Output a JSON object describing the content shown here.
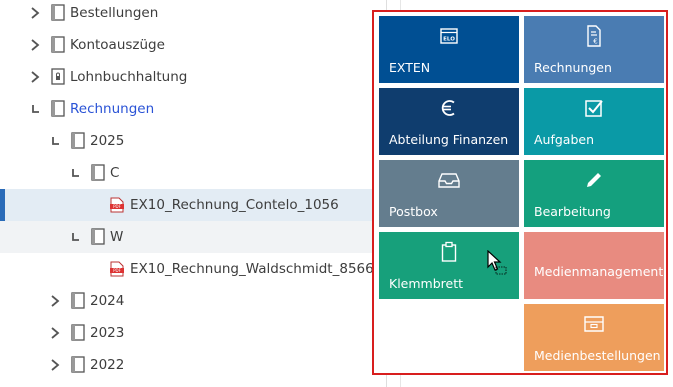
{
  "tree": {
    "items": [
      {
        "label": "Bestellungen",
        "type": "folder",
        "state": "collapsed"
      },
      {
        "label": "Kontoauszüge",
        "type": "folder",
        "state": "collapsed"
      },
      {
        "label": "Lohnbuchhaltung",
        "type": "folder-locked",
        "state": "collapsed"
      },
      {
        "label": "Rechnungen",
        "type": "folder",
        "state": "expanded"
      },
      {
        "label": "2025",
        "type": "folder",
        "state": "expanded"
      },
      {
        "label": "C",
        "type": "folder",
        "state": "expanded"
      },
      {
        "label": "EX10_Rechnung_Contelo_1056",
        "type": "pdf",
        "state": "selected"
      },
      {
        "label": "W",
        "type": "folder",
        "state": "expanded"
      },
      {
        "label": "EX10_Rechnung_Waldschmidt_8566",
        "type": "pdf",
        "state": "none"
      },
      {
        "label": "2024",
        "type": "folder",
        "state": "collapsed"
      },
      {
        "label": "2023",
        "type": "folder",
        "state": "collapsed"
      },
      {
        "label": "2022",
        "type": "folder",
        "state": "collapsed"
      }
    ]
  },
  "tiles": [
    {
      "label": "EXTEN",
      "icon": "elo-window-icon",
      "color": "#004f93"
    },
    {
      "label": "Rechnungen",
      "icon": "invoice-document-icon",
      "color": "#4a7cb2"
    },
    {
      "label": "Abteilung Finanzen",
      "icon": "euro-icon",
      "color": "#0f3d6e"
    },
    {
      "label": "Aufgaben",
      "icon": "checkbox-icon",
      "color": "#0a9aa6"
    },
    {
      "label": "Postbox",
      "icon": "inbox-icon",
      "color": "#647d8e"
    },
    {
      "label": "Bearbeitung",
      "icon": "pencil-icon",
      "color": "#14a07e"
    },
    {
      "label": "Klemmbrett",
      "icon": "clipboard-icon",
      "color": "#17a07b"
    },
    {
      "label": "Medienmanagement",
      "icon": "none",
      "color": "#e88b80"
    },
    {
      "label": "Medienbestellungen",
      "icon": "media-orders-icon",
      "color": "#ee9e5c"
    }
  ],
  "colors": {
    "panel_border": "#d81e1e",
    "active_link": "#2a53d6",
    "selection_bg": "#e3ecf4",
    "selection_bar": "#2a6bb8"
  }
}
